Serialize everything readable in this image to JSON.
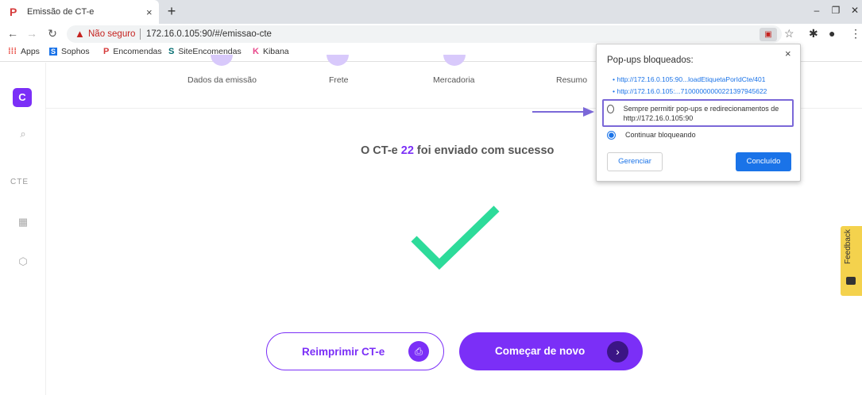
{
  "browser": {
    "tab_title": "Emissão de CT-e",
    "tab_favicon": "P",
    "tab_close": "×",
    "new_tab": "+",
    "window_minimize": "–",
    "window_restore": "❐",
    "window_close": "✕",
    "security_label": "Não seguro",
    "url": "172.16.0.105:90/#/emissao-cte"
  },
  "bookmarks": [
    {
      "label": "Apps",
      "icon": "apps-grid-icon"
    },
    {
      "label": "Sophos",
      "icon": "sophos-icon"
    },
    {
      "label": "Encomendas",
      "icon": "encomendas-icon"
    },
    {
      "label": "SiteEncomendas",
      "icon": "sharepoint-icon"
    },
    {
      "label": "Kibana",
      "icon": "kibana-icon"
    }
  ],
  "sidebar": {
    "cte_label": "CTE"
  },
  "steps": [
    {
      "label": "Dados da emissão"
    },
    {
      "label": "Frete"
    },
    {
      "label": "Mercadoria"
    },
    {
      "label": "Resumo"
    }
  ],
  "main": {
    "success_prefix": "O CT-e ",
    "success_number": "22",
    "success_suffix": " foi enviado com sucesso",
    "reprint_label": "Reimprimir CT-e",
    "restart_label": "Começar de novo"
  },
  "feedback": {
    "label": "Feedback"
  },
  "popup": {
    "title": "Pop-ups bloqueados:",
    "close": "×",
    "links": [
      "http://172.16.0.105:90...loadEtiquetaPorIdCte/401",
      "http://172.16.0.105:...7100000000022139794562​2"
    ],
    "option_allow": "Sempre permitir pop-ups e redirecionamentos de http://172.16.0.105:90",
    "option_block": "Continuar bloqueando",
    "manage_label": "Gerenciar",
    "done_label": "Concluído"
  },
  "colors": {
    "accent": "#7b2ff7",
    "success_check": "#2ddb9a",
    "feedback_tab": "#f4d24d",
    "chrome_blue": "#1a73e8"
  }
}
